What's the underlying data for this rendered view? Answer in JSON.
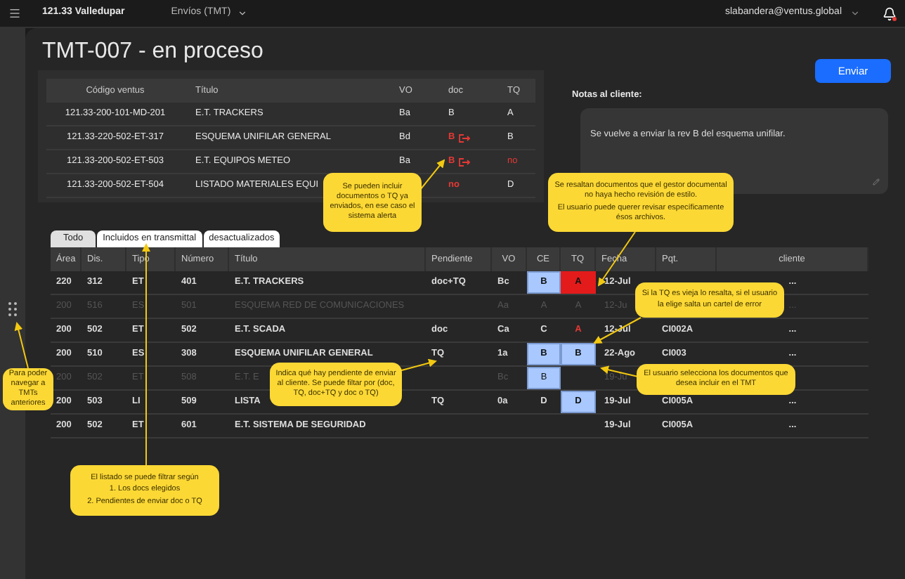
{
  "header": {
    "project": "121.33 Valledupar",
    "module": "Envíos (TMT)",
    "user": "slabandera@ventus.global",
    "notification": true
  },
  "page_title": "TMT-007 - en proceso",
  "sent_table": {
    "columns": [
      "Código ventus",
      "Título",
      "VO",
      "doc",
      "TQ"
    ],
    "rows": [
      {
        "code": "121.33-200-101-MD-201",
        "title": "E.T. TRACKERS",
        "vo": "Ba",
        "doc": "B",
        "doc_alert": false,
        "doc_icon": false,
        "tq": "A",
        "tq_alert": false
      },
      {
        "code": "121.33-220-502-ET-317",
        "title": "ESQUEMA UNIFILAR GENERAL",
        "vo": "Bd",
        "doc": "B",
        "doc_alert": true,
        "doc_icon": true,
        "tq": "B",
        "tq_alert": false
      },
      {
        "code": "121.33-200-502-ET-503",
        "title": "E.T. EQUIPOS METEO",
        "vo": "Ba",
        "doc": "B",
        "doc_alert": true,
        "doc_icon": true,
        "tq": "no",
        "tq_alert": true
      },
      {
        "code": "121.33-200-502-ET-504",
        "title": "LISTADO MATERIALES EQUI",
        "doc": "no",
        "doc_alert": true,
        "doc_icon": false,
        "tq": "D",
        "tq_alert": false
      }
    ]
  },
  "send_button": "Enviar",
  "notes": {
    "label": "Notas al cliente:",
    "value": "Se vuelve a enviar la rev B del esquema unifilar."
  },
  "filter_tabs": [
    {
      "label": "Todo",
      "selected": true
    },
    {
      "label": "Incluidos en transmittal",
      "selected": false
    },
    {
      "label": "desactualizados",
      "selected": false
    }
  ],
  "list": {
    "columns": [
      "Área",
      "Dis.",
      "Tipo",
      "Número",
      "Título",
      "Pendiente",
      "VO",
      "CE",
      "TQ",
      "Fecha",
      "Pqt.",
      "cliente"
    ],
    "rows": [
      {
        "area": "220",
        "dis": "312",
        "tipo": "ET",
        "numero": "401",
        "titulo": "E.T. TRACKERS",
        "pendiente": "doc+TQ",
        "vo": "Bc",
        "ce": "B",
        "ce_selected": true,
        "tq": "A",
        "tq_selected": true,
        "tq_alert": true,
        "fecha": "12-Jul",
        "cliente": "...",
        "disabled": false
      },
      {
        "area": "200",
        "dis": "516",
        "tipo": "ES",
        "numero": "501",
        "titulo": "ESQUEMA RED DE COMUNICACIONES",
        "vo": "Aa",
        "ce": "A",
        "ce_selected": false,
        "tq": "A",
        "tq_selected": false,
        "tq_alert": false,
        "fecha": "12-Ju",
        "cliente": "...",
        "disabled": true
      },
      {
        "area": "200",
        "dis": "502",
        "tipo": "ET",
        "numero": "502",
        "titulo": "E.T. SCADA",
        "pendiente": "doc",
        "vo": "Ca",
        "ce": "C",
        "ce_selected": false,
        "tq": "A",
        "tq_selected": false,
        "tq_alert": true,
        "fecha": "12-Jul",
        "pqt": "CI002A",
        "cliente": "...",
        "disabled": false
      },
      {
        "area": "200",
        "dis": "510",
        "tipo": "ES",
        "numero": "308",
        "titulo": "ESQUEMA UNIFILAR GENERAL",
        "pendiente": "TQ",
        "vo": "1a",
        "ce": "B",
        "ce_selected": true,
        "tq": "B",
        "tq_selected": true,
        "tq_alert": false,
        "fecha": "22-Ago",
        "pqt": "CI003",
        "cliente": "...",
        "disabled": false
      },
      {
        "area": "200",
        "dis": "502",
        "tipo": "ET",
        "numero": "508",
        "titulo": "E.T. E",
        "vo": "Bc",
        "ce": "B",
        "ce_selected": true,
        "tq_selected": false,
        "tq_alert": false,
        "fecha": "19-Ju",
        "disabled": true
      },
      {
        "area": "200",
        "dis": "503",
        "tipo": "LI",
        "numero": "509",
        "titulo": "LISTA",
        "pendiente": "TQ",
        "vo": "0a",
        "ce": "D",
        "ce_selected": false,
        "tq": "D",
        "tq_selected": true,
        "tq_alert": false,
        "fecha": "19-Jul",
        "pqt": "CI005A",
        "cliente": "...",
        "disabled": false
      },
      {
        "area": "200",
        "dis": "502",
        "tipo": "ET",
        "numero": "601",
        "titulo": "E.T. SISTEMA DE SEGURIDAD",
        "fecha": "19-Jul",
        "pqt": "CI005A",
        "cliente": "...",
        "disabled": false
      }
    ]
  },
  "annotations": [
    {
      "lines": [
        "Se pueden incluir documentos o TQ ya enviados, en ese caso el sistema alerta"
      ]
    },
    {
      "lines": [
        "Se resaltan documentos que el gestor documental no haya hecho revisión de estilo.",
        "El usuario puede querer revisar específicamente ésos archivos."
      ]
    },
    {
      "lines": [
        "Si la TQ es vieja lo resalta, si el usuario la elige salta un cartel de error"
      ]
    },
    {
      "lines": [
        "Para poder navegar a TMTs anteriores"
      ]
    },
    {
      "lines": [
        "Indica qué hay pendiente de enviar al cliente. Se puede filtar por (doc, TQ, doc+TQ y doc o TQ)"
      ]
    },
    {
      "lines": [
        "El usuario selecciona los documentos que desea incluir en el TMT"
      ]
    },
    {
      "lines": [
        "El listado se puede filtrar según",
        "1. Los docs elegidos",
        "2. Pendientes de enviar doc o TQ"
      ]
    }
  ]
}
